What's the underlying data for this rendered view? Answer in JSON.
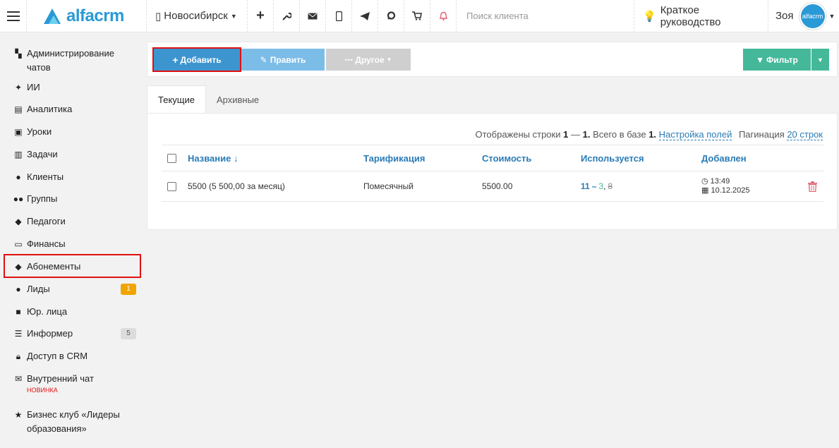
{
  "header": {
    "logo_text": "alfacrm",
    "city": "Новосибирск",
    "search_placeholder": "Поиск клиента",
    "guide_label": "Краткое руководство",
    "user_name": "Зоя",
    "avatar_text": "alfacrm"
  },
  "sidebar": {
    "items": [
      {
        "label": "Администрирование чатов",
        "icon": "chat-admin-icon"
      },
      {
        "label": "ИИ",
        "icon": "sparkle-icon"
      },
      {
        "label": "Аналитика",
        "icon": "map-icon"
      },
      {
        "label": "Уроки",
        "icon": "calendar-icon"
      },
      {
        "label": "Задачи",
        "icon": "clipboard-icon"
      },
      {
        "label": "Клиенты",
        "icon": "user-icon"
      },
      {
        "label": "Группы",
        "icon": "users-icon"
      },
      {
        "label": "Педагоги",
        "icon": "graduation-cap-icon"
      },
      {
        "label": "Финансы",
        "icon": "money-icon"
      },
      {
        "label": "Абонементы",
        "icon": "tag-icon"
      },
      {
        "label": "Лиды",
        "icon": "user-plus-icon",
        "badge": "1"
      },
      {
        "label": "Юр. лица",
        "icon": "briefcase-icon"
      },
      {
        "label": "Информер",
        "icon": "list-icon",
        "badge": "5"
      },
      {
        "label": "Доступ в CRM",
        "icon": "lock-icon"
      },
      {
        "label": "Внутренний чат",
        "icon": "envelope-icon",
        "tag": "НОВИНКА"
      },
      {
        "label": "Бизнес клуб «Лидеры образования»",
        "icon": "star-icon"
      }
    ]
  },
  "toolbar": {
    "add_label": "Добавить",
    "edit_label": "Править",
    "other_label": "Другое",
    "filter_label": "Фильтр"
  },
  "tabs": {
    "current": "Текущие",
    "archive": "Архивные"
  },
  "meta": {
    "shown_prefix": "Отображены строки",
    "shown_from": "1",
    "dash": "—",
    "shown_to": "1.",
    "total_label": "Всего в базе",
    "total": "1.",
    "fields_link": "Настройка полей",
    "pagination_label": "Пагинация",
    "pagination_link": "20 строк"
  },
  "table": {
    "columns": [
      "Название ↓",
      "Тарификация",
      "Стоимость",
      "Используется",
      "Добавлен"
    ],
    "rows": [
      {
        "name": "5500 (5 500,00 за месяц)",
        "billing": "Помесячный",
        "cost": "5500.00",
        "used_a": "11",
        "used_sep": "–",
        "used_b": "3",
        "used_comma": ",",
        "used_c": "8",
        "added_time": "13:49",
        "added_date": "10.12.2025"
      }
    ]
  }
}
